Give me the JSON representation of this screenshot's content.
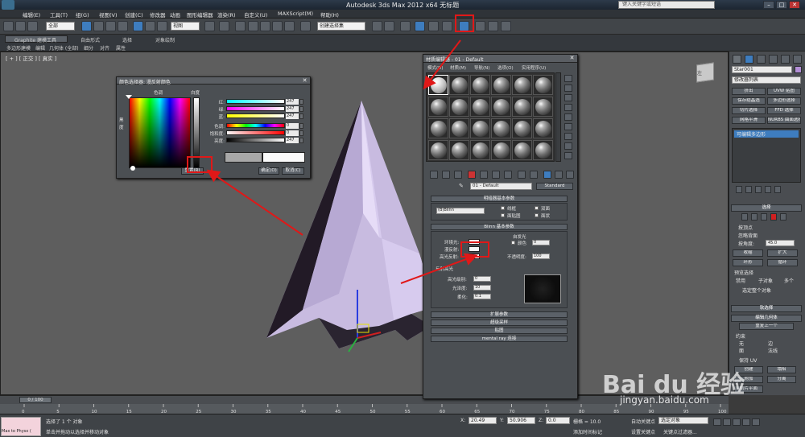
{
  "window": {
    "title": "Autodesk 3ds Max  2012 x64     无标题",
    "search_placeholder": "键入关键字或短语",
    "min": "–",
    "max": "□",
    "close": "✕"
  },
  "menubar": [
    "编辑(E)",
    "工具(T)",
    "组(G)",
    "视图(V)",
    "创建(C)",
    "修改器",
    "动画",
    "图形编辑器",
    "渲染(R)",
    "自定义(U)",
    "MAXScript(M)",
    "帮助(H)"
  ],
  "toolbar": {
    "filter_select": "全部",
    "ref_coord_select": "视图",
    "named_sel_select": "创建选择集"
  },
  "ribbon": {
    "tabs": [
      "Graphite 建模工具",
      "自由形式",
      "选择",
      "对象绘制"
    ],
    "sub": [
      "多边形建模",
      "编辑",
      "几何体 (全部)",
      "细分",
      "对齐",
      "属性"
    ]
  },
  "viewport": {
    "label": "[ + ] [ 正交 ] [ 真实 ]",
    "viewcube_label": "左"
  },
  "color_dialog": {
    "title": "颜色选择器: 漫反射颜色",
    "hue_label": "色调",
    "whiteness_label": "白度",
    "black_label": "黑\n度",
    "sliders": [
      {
        "label": "红:",
        "value": "247"
      },
      {
        "label": "绿:",
        "value": "247"
      },
      {
        "label": "蓝:",
        "value": "247"
      },
      {
        "label": "色调:",
        "value": "0"
      },
      {
        "label": "饱和度:",
        "value": "0"
      },
      {
        "label": "亮度:",
        "value": "247"
      }
    ],
    "reset_label": "重置(R)",
    "ok_label": "确定(O)",
    "cancel_label": "取消(C)"
  },
  "material_editor": {
    "title": "材质编辑器 - 01 - Default",
    "menu": [
      "模式(D)",
      "材质(M)",
      "导航(N)",
      "选项(O)",
      "实用程序(U)"
    ],
    "material_name": "01 - Default",
    "material_type": "Standard",
    "shader_basic": {
      "header": "明暗器基本参数",
      "shader": "(B)Blinn",
      "wire": "线框",
      "two_sided": "双面",
      "face_map": "面贴图",
      "faceted": "面状"
    },
    "blinn_basic": {
      "header": "Blinn 基本参数",
      "self_illum_label": "自发光",
      "color_label": "颜色",
      "color_value": "0",
      "ambient_label": "环境光:",
      "diffuse_label": "漫反射:",
      "specular_label": "高光反射:",
      "opacity_label": "不透明度:",
      "opacity_value": "100",
      "spec_highlights": "反射高光",
      "spec_level_label": "高光级别:",
      "spec_level_value": "0",
      "glossiness_label": "光泽度:",
      "glossiness_value": "10",
      "soften_label": "柔化:",
      "soften_value": "0.1"
    },
    "rollouts": [
      "扩展参数",
      "超级采样",
      "贴图",
      "mental ray 连接"
    ]
  },
  "command_panel": {
    "object_name": "Star001",
    "modifier_list": "修改器列表",
    "buttons": [
      "挤出",
      "UVW 贴图",
      "保存结晶选",
      "多边形选择",
      "切片选择",
      "FFD 选择",
      "网格平滑",
      "NURBS 曲面选择"
    ],
    "stack_item": "可编辑多边形",
    "selection_header": "选择",
    "by_vertex": "按顶点",
    "ignore_backfacing": "忽略背面",
    "by_angle": "按角度:",
    "angle_value": "45.0",
    "shrink": "收缩",
    "grow": "扩大",
    "ring": "环形",
    "loop": "循环",
    "preview_header": "预览选择",
    "preview_off": "禁用",
    "preview_subobj": "子对象",
    "preview_multi": "多个",
    "selected_count": "选定整个对象",
    "soft_selection": "软选择",
    "edit_geometry": "编辑几何体",
    "repeat_last": "重复上一个",
    "constraints": "约束",
    "none": "无",
    "edge": "边",
    "face": "面",
    "normal": "法线",
    "preserve_uv": "保持 UV",
    "create": "创建",
    "collapse": "塌陷",
    "attach": "附加",
    "detach": "分离",
    "slice_plane": "切片平面",
    "cut": "切割",
    "reset_plane": "重置平面",
    "slice": "切片"
  },
  "trackbar": {
    "frame": "0 / 100",
    "ticks": [
      "0",
      "5",
      "10",
      "15",
      "20",
      "25",
      "30",
      "35",
      "40",
      "45",
      "50",
      "55",
      "60",
      "65",
      "70",
      "75",
      "80",
      "85",
      "90",
      "95",
      "100"
    ]
  },
  "status": {
    "maxscript": "Max to Physx (",
    "selected": "选择了 1 个 对象",
    "prompt": "单击并拖动以选择并移动对象",
    "x_label": "X:",
    "x_value": "20.49",
    "y_label": "Y:",
    "y_value": "50.906",
    "z_label": "Z:",
    "z_value": "0.0",
    "grid": "栅格 = 10.0",
    "add_time_tag": "添加时间标记",
    "auto_key": "自动关键点",
    "selected_obj": "选定对象",
    "set_key": "设置关键点",
    "key_filters": "关键点过滤器..."
  },
  "watermark": {
    "logo": "Bai du 经验",
    "url": "jingyan.baidu.com"
  }
}
